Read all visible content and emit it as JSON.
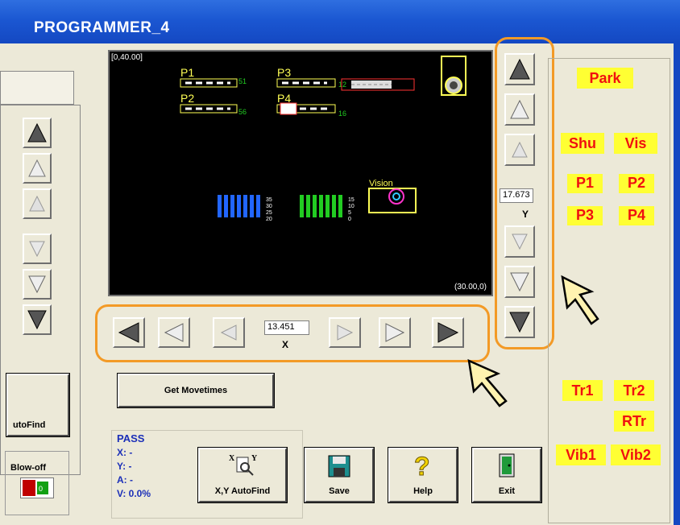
{
  "window": {
    "title": "PROGRAMMER_4"
  },
  "canvas": {
    "top_left_coord": "[0,40.00]",
    "bottom_right_coord": "(30.00,0)",
    "labels": {
      "p1": "P1",
      "p2": "P2",
      "p3": "P3",
      "p4": "P4",
      "vision": "Vision"
    }
  },
  "y_axis": {
    "value": "17.673",
    "label": "Y"
  },
  "x_axis": {
    "value": "13.451",
    "label": "X"
  },
  "buttons": {
    "get_movetimes": "Get Movetimes",
    "xy_autofind": "X,Y AutoFind",
    "save": "Save",
    "help": "Help",
    "exit": "Exit"
  },
  "status": {
    "state": "PASS",
    "x": "X: -",
    "y": "Y: -",
    "a": "A: -",
    "v": "V: 0.0%"
  },
  "left_panel": {
    "autofind_partial": "utoFind",
    "blowoff": "Blow-off"
  },
  "positions": {
    "park": "Park",
    "shu": "Shu",
    "vis": "Vis",
    "p1": "P1",
    "p2": "P2",
    "p3": "P3",
    "p4": "P4",
    "tr1": "Tr1",
    "tr2": "Tr2",
    "rtr": "RTr",
    "vib1": "Vib1",
    "vib2": "Vib2"
  },
  "colors": {
    "title_bar": "#1b57d2",
    "highlight": "#f39a26",
    "position_bg": "#ffff33",
    "position_text": "#f01010",
    "status_text": "#1b2fb8"
  }
}
